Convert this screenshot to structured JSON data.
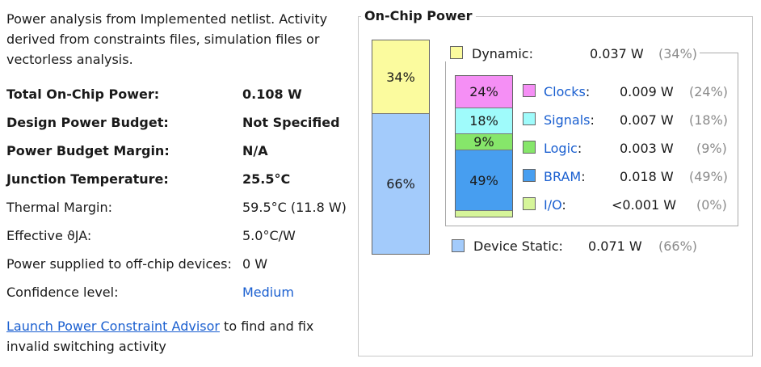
{
  "intro": "Power analysis from Implemented netlist. Activity derived from constraints files, simulation files or vectorless analysis.",
  "summary": [
    {
      "label": "Total On-Chip Power:",
      "value": "0.108 W",
      "bold": true
    },
    {
      "label": "Design Power Budget:",
      "value": "Not Specified",
      "bold": true
    },
    {
      "label": "Power Budget Margin:",
      "value": "N/A",
      "bold": true
    },
    {
      "label": "Junction Temperature:",
      "value": "25.5°C",
      "bold": true
    },
    {
      "label": "Thermal Margin:",
      "value": "59.5°C (11.8 W)",
      "bold": false
    },
    {
      "label": "Effective ϑJA:",
      "value": "5.0°C/W",
      "bold": false
    },
    {
      "label": "Power supplied to off-chip devices:",
      "value": "0 W",
      "bold": false
    },
    {
      "label": "Confidence level:",
      "value": "Medium",
      "bold": false
    }
  ],
  "footer": {
    "link": "Launch Power Constraint Advisor",
    "text": " to find and fix invalid switching activity"
  },
  "panel": {
    "title": "On-Chip Power",
    "dynamic": {
      "label": "Dynamic:",
      "value": "0.037 W",
      "pct": "(34%)",
      "bar_pct": "34%",
      "color": "#fbfb9e"
    },
    "static": {
      "label": "Device Static:",
      "value": "0.071 W",
      "pct": "(66%)",
      "bar_pct": "66%",
      "color": "#a3cbfb"
    },
    "breakdown": [
      {
        "name": "Clocks",
        "value": "0.009 W",
        "pct": "(24%)",
        "bar_pct": "24%",
        "color": "#f58ff5"
      },
      {
        "name": "Signals",
        "value": "0.007 W",
        "pct": "(18%)",
        "bar_pct": "18%",
        "color": "#9ffbfb"
      },
      {
        "name": "Logic",
        "value": "0.003 W",
        "pct": "(9%)",
        "bar_pct": "9%",
        "color": "#86e66a"
      },
      {
        "name": "BRAM",
        "value": "0.018 W",
        "pct": "(49%)",
        "bar_pct": "49%",
        "color": "#479ef0"
      },
      {
        "name": "I/O",
        "value": "<0.001 W",
        "pct": "(0%)",
        "bar_pct": "",
        "color": "#d6f59a"
      }
    ]
  }
}
